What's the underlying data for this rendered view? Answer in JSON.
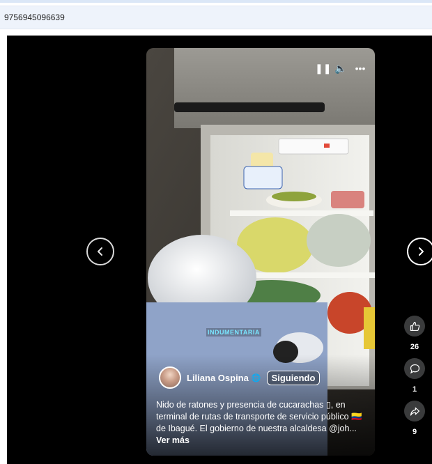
{
  "browser": {
    "url_fragment": "9756945096639"
  },
  "video": {
    "ticker_text": "INDUMENTARIA",
    "controls": [
      {
        "name": "pause-icon",
        "glyph": "❚❚"
      },
      {
        "name": "volume-icon",
        "glyph": "🔈"
      },
      {
        "name": "more-options-icon",
        "glyph": "•••"
      }
    ]
  },
  "author": {
    "name": "Liliana Ospina",
    "globe_glyph": "🌐",
    "follow_label": "Siguiendo"
  },
  "caption": {
    "text": "Nido de ratones y presencia de cucarachas ▯, en terminal de rutas de transporte de servicio público 🇨🇴 de Ibagué. El gobierno de nuestra alcaldesa @joh...",
    "see_more": "Ver más"
  },
  "actions": {
    "likes": "26",
    "comments": "1",
    "shares": "9"
  }
}
